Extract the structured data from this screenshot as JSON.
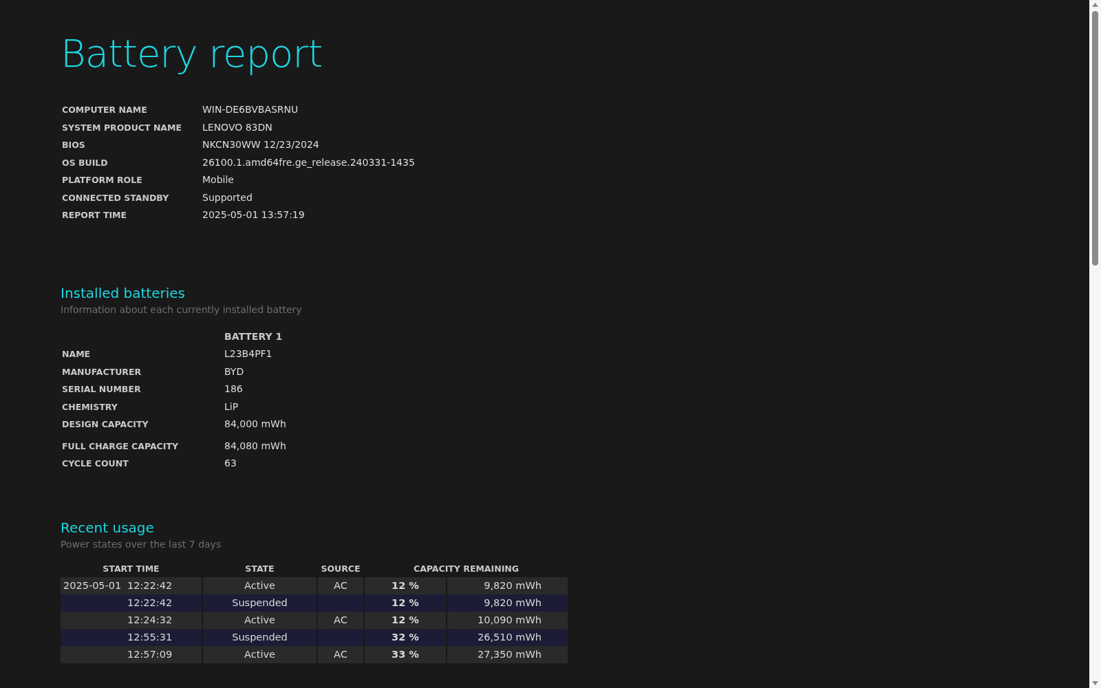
{
  "title": "Battery report",
  "system_info": [
    {
      "label": "COMPUTER NAME",
      "value": "WIN-DE6BVBASRNU"
    },
    {
      "label": "SYSTEM PRODUCT NAME",
      "value": "LENOVO 83DN"
    },
    {
      "label": "BIOS",
      "value": "NKCN30WW 12/23/2024"
    },
    {
      "label": "OS BUILD",
      "value": "26100.1.amd64fre.ge_release.240331-1435"
    },
    {
      "label": "PLATFORM ROLE",
      "value": "Mobile"
    },
    {
      "label": "CONNECTED STANDBY",
      "value": "Supported"
    },
    {
      "label": "REPORT TIME",
      "value": "2025-05-01  13:57:19"
    }
  ],
  "installed_batteries": {
    "heading": "Installed batteries",
    "subtitle": "Information about each currently installed battery",
    "column": "BATTERY 1",
    "rows": [
      {
        "label": "NAME",
        "value": "L23B4PF1"
      },
      {
        "label": "MANUFACTURER",
        "value": "BYD"
      },
      {
        "label": "SERIAL NUMBER",
        "value": "186"
      },
      {
        "label": "CHEMISTRY",
        "value": "LiP"
      },
      {
        "label": "DESIGN CAPACITY",
        "value": "84,000 mWh"
      },
      {
        "label": "FULL CHARGE CAPACITY",
        "value": "84,080 mWh"
      },
      {
        "label": "CYCLE COUNT",
        "value": "63"
      }
    ]
  },
  "recent_usage": {
    "heading": "Recent usage",
    "subtitle": "Power states over the last 7 days",
    "columns": [
      "START TIME",
      "STATE",
      "SOURCE",
      "CAPACITY REMAINING"
    ],
    "rows": [
      {
        "date": "2025-05-01",
        "time": "12:22:42",
        "state": "Active",
        "source": "AC",
        "percent": "12 %",
        "energy": "9,820 mWh"
      },
      {
        "time": "12:22:42",
        "state": "Suspended",
        "percent": "12 %",
        "energy": "9,820 mWh"
      },
      {
        "time": "12:24:32",
        "state": "Active",
        "source": "AC",
        "percent": "12 %",
        "energy": "10,090 mWh"
      },
      {
        "time": "12:55:31",
        "state": "Suspended",
        "percent": "32 %",
        "energy": "26,510 mWh"
      },
      {
        "time": "12:57:09",
        "state": "Active",
        "source": "AC",
        "percent": "33 %",
        "energy": "27,350 mWh"
      }
    ]
  }
}
